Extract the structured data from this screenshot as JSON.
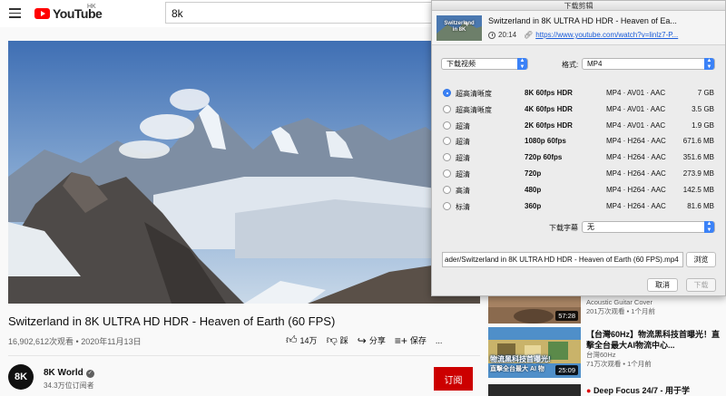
{
  "youtube": {
    "logo_text": "YouTube",
    "region": "HK",
    "search_value": "8k",
    "video": {
      "title": "Switzerland in 8K ULTRA HD HDR - Heaven of Earth (60 FPS)",
      "stats": "16,902,612次观看 • 2020年11月13日",
      "likes": "14万",
      "dislike": "踩",
      "share": "分享",
      "save": "保存",
      "more": "..."
    },
    "channel": {
      "avatar_text": "8K",
      "name": "8K World",
      "subscribers": "34.3万位订阅者",
      "subscribe_label": "订阅"
    },
    "recommendations": [
      {
        "title": "",
        "meta1": "Acoustic Guitar Cover",
        "meta2": "201万次观看 • 1个月前",
        "duration": "57:28"
      },
      {
        "title": "【台灣60Hz】物流黑科技首曝光！直擊全台最大AI物流中心...",
        "meta1": "台灣60Hz",
        "meta2": "71万次观看 • 1个月前",
        "duration": "25:09",
        "thumb_text_1": "物流黑科技首曝光!",
        "thumb_text_2": "直擊全台最大 AI 物"
      },
      {
        "title": "Deep Focus 24/7 - 用于学",
        "meta1": "",
        "meta2": "",
        "duration": ""
      }
    ]
  },
  "downloader": {
    "window_title": "下载剪辑",
    "thumb_label_1": "Switzerland",
    "thumb_label_2": "in 8K",
    "video_title": "Switzerland in 8K ULTRA HD HDR - Heaven of Ea...",
    "duration": "20:14",
    "url": "https://www.youtube.com/watch?v=linlz7-P...",
    "mode_select": "下载视频",
    "format_label": "格式:",
    "format_select": "MP4",
    "formats": [
      {
        "quality": "超高清晰度",
        "resolution": "8K 60fps HDR",
        "codec": "MP4 · AV01 · AAC",
        "size": "7 GB",
        "selected": true
      },
      {
        "quality": "超高清晰度",
        "resolution": "4K 60fps HDR",
        "codec": "MP4 · AV01 · AAC",
        "size": "3.5 GB",
        "selected": false
      },
      {
        "quality": "超清",
        "resolution": "2K 60fps HDR",
        "codec": "MP4 · AV01 · AAC",
        "size": "1.9 GB",
        "selected": false
      },
      {
        "quality": "超清",
        "resolution": "1080p 60fps",
        "codec": "MP4 · H264 · AAC",
        "size": "671.6 MB",
        "selected": false
      },
      {
        "quality": "超清",
        "resolution": "720p 60fps",
        "codec": "MP4 · H264 · AAC",
        "size": "351.6 MB",
        "selected": false
      },
      {
        "quality": "超清",
        "resolution": "720p",
        "codec": "MP4 · H264 · AAC",
        "size": "273.9 MB",
        "selected": false
      },
      {
        "quality": "高清",
        "resolution": "480p",
        "codec": "MP4 · H264 · AAC",
        "size": "142.5 MB",
        "selected": false
      },
      {
        "quality": "标清",
        "resolution": "360p",
        "codec": "MP4 · H264 · AAC",
        "size": "81.6 MB",
        "selected": false
      }
    ],
    "subtitle_label": "下载字幕",
    "subtitle_select": "无",
    "save_path": "ader/Switzerland in 8K ULTRA HD HDR - Heaven of Earth (60 FPS).mp4",
    "browse_label": "浏览",
    "cancel_label": "取消",
    "download_label": "下载"
  }
}
